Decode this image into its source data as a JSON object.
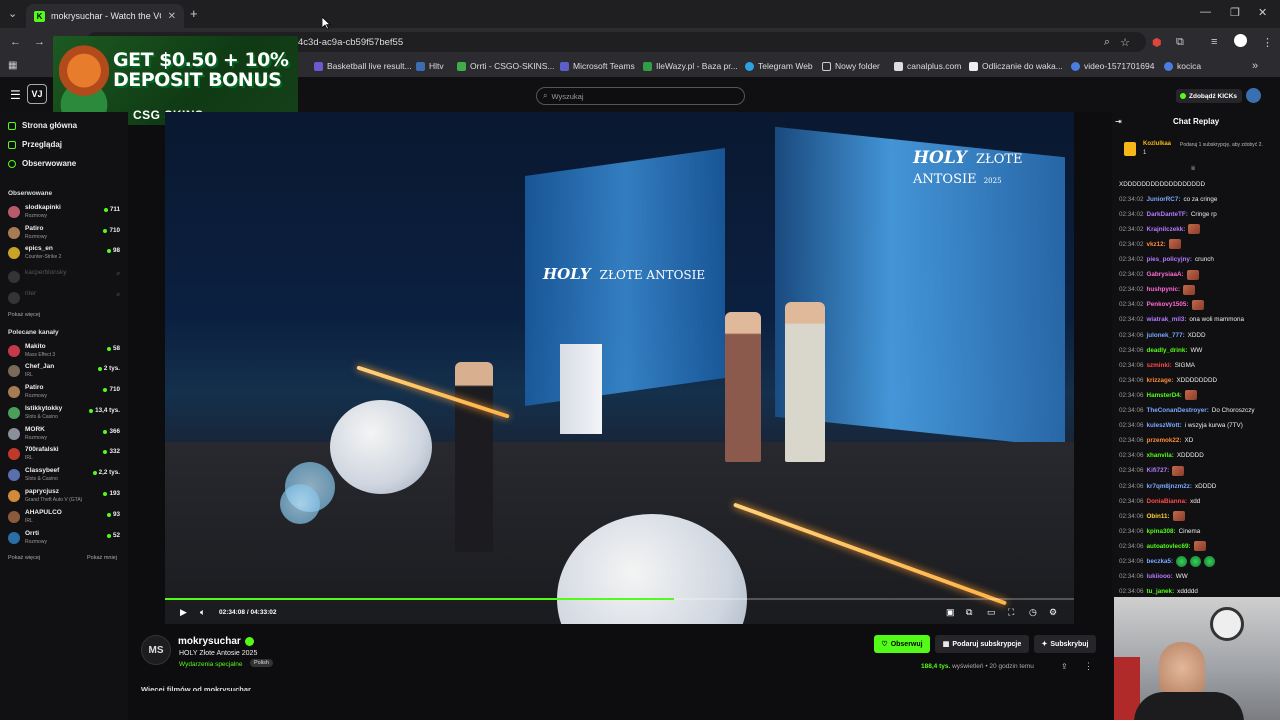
{
  "browser": {
    "tab_title": "mokrysuchar - Watch the VOD",
    "tab_favicon": "K",
    "url_fragment": "4c3d-ac9a-cb59f57bef55",
    "bookmarks": [
      "Basketball live result...",
      "Hltv",
      "Orrti - CSGO-SKINS...",
      "Microsoft Teams",
      "IleWazy.pl - Baza pr...",
      "Telegram Web",
      "Nowy folder",
      "canalplus.com",
      "Odliczanie do waka...",
      "video-1571701694",
      "kocica"
    ]
  },
  "ad": {
    "headline": "GET $0.50 + 10% DEPOSIT BONUS",
    "brand": "CSG SKINS"
  },
  "header": {
    "logo": "VJ",
    "search_placeholder": "Wyszukaj",
    "kicks_button": "Zdobądź KICKs"
  },
  "sidebar": {
    "nav": [
      {
        "label": "Strona główna"
      },
      {
        "label": "Przeglądaj"
      },
      {
        "label": "Obserwowane"
      }
    ],
    "followed_title": "Obserwowane",
    "followed": [
      {
        "name": "slodkapinki",
        "category": "Rozmowy",
        "viewers": "711"
      },
      {
        "name": "Patiro",
        "category": "Rozmowy",
        "viewers": "710"
      },
      {
        "name": "epics_en",
        "category": "Counter-Strike 2",
        "viewers": "98"
      },
      {
        "name": "kacperblonsky",
        "category": "",
        "viewers": ""
      },
      {
        "name": "riter",
        "category": "",
        "viewers": ""
      }
    ],
    "show_more_followed": "Pokaż więcej",
    "recommended_title": "Polecane kanały",
    "recommended": [
      {
        "name": "Makito",
        "category": "Mass Effect 3",
        "viewers": "58"
      },
      {
        "name": "Chef_Jan",
        "category": "IRL",
        "viewers": "2 tys."
      },
      {
        "name": "Patiro",
        "category": "Rozmowy",
        "viewers": "710"
      },
      {
        "name": "Istikkytokky",
        "category": "Slots & Casino",
        "viewers": "13,4 tys."
      },
      {
        "name": "MORK",
        "category": "Rozmowy",
        "viewers": "366"
      },
      {
        "name": "700rafalski",
        "category": "IRL",
        "viewers": "332"
      },
      {
        "name": "Classybeef",
        "category": "Slots & Casino",
        "viewers": "2,2 tys."
      },
      {
        "name": "paprycjusz",
        "category": "Grand Theft Auto V (GTA)",
        "viewers": "193"
      },
      {
        "name": "AHAPULCO",
        "category": "IRL",
        "viewers": "93"
      },
      {
        "name": "Orrti",
        "category": "Rozmowy",
        "viewers": "52"
      }
    ],
    "show_more_recommended": "Pokaż więcej",
    "show_less_recommended": "Pokaż mniej"
  },
  "player": {
    "stage_logo_brand": "HOLY",
    "stage_logo_title": "ZŁOTE ANTOSIE",
    "stage_logo_year": "2025",
    "time_current": "02:34:08",
    "time_total": "04:33:02",
    "progress": 0.56
  },
  "vod": {
    "channel_avatar": "MS",
    "channel_name": "mokrysuchar",
    "title": "HOLY Złote Antosie 2025",
    "category": "Wydarzenia specjalne",
    "language": "Polish",
    "follow_label": "Obserwuj",
    "gift_label": "Podaruj subskrypcje",
    "subscribe_label": "Subskrybuj",
    "views_count": "188,4 tys.",
    "views_label": "wyświetleń",
    "age": "20 godzin temu",
    "more_vods": "Więcej filmów od mokrysuchar"
  },
  "chat": {
    "title": "Chat Replay",
    "pinned_user": "Kozlulkaa",
    "pinned_count": "1",
    "pinned_text": "Podaruj 1 subskrypcję, aby zdobyć 2.",
    "messages": [
      {
        "time": "",
        "user": "",
        "text": "XDDDDDDDDDDDDDDDDDD",
        "color": "#eeeeee"
      },
      {
        "time": "02:34:02",
        "user": "JuniorRC7:",
        "text": "co za cringe",
        "color": "#7aa8ff"
      },
      {
        "time": "02:34:02",
        "user": "DarkDanteTF:",
        "text": "Cringe rp",
        "color": "#b47aff"
      },
      {
        "time": "02:34:02",
        "user": "Krajnilczekk:",
        "text": "",
        "color": "#b47aff",
        "emote": "face"
      },
      {
        "time": "02:34:02",
        "user": "vkz12:",
        "text": "",
        "color": "#ff8a3a",
        "emote": "face"
      },
      {
        "time": "02:34:02",
        "user": "pies_policyjny:",
        "text": "crunch",
        "color": "#b47aff"
      },
      {
        "time": "02:34:02",
        "user": "GabrysiaaA:",
        "text": "",
        "color": "#ff6ad5",
        "emote": "face"
      },
      {
        "time": "02:34:02",
        "user": "hushpynic:",
        "text": "",
        "color": "#ff6ad5",
        "emote": "face"
      },
      {
        "time": "02:34:02",
        "user": "Penkovy1505:",
        "text": "",
        "color": "#ff6ad5",
        "emote": "face"
      },
      {
        "time": "02:34:02",
        "user": "wiatrak_mil3:",
        "text": "ona woli mammona",
        "color": "#b47aff"
      },
      {
        "time": "02:34:06",
        "user": "julonek_777:",
        "text": "XDDD",
        "color": "#7aa8ff"
      },
      {
        "time": "02:34:06",
        "user": "deadly_drink:",
        "text": "WW",
        "color": "#53fc18"
      },
      {
        "time": "02:34:06",
        "user": "szminki:",
        "text": "SIGMA",
        "color": "#ff4a4a"
      },
      {
        "time": "02:34:06",
        "user": "krizzage:",
        "text": "XDDDDDDDD",
        "color": "#ff8a3a"
      },
      {
        "time": "02:34:06",
        "user": "HamsterD4:",
        "text": "",
        "color": "#53fc18",
        "emote": "face"
      },
      {
        "time": "02:34:06",
        "user": "TheConanDestroyer:",
        "text": "Do Choroszczy",
        "color": "#7aa8ff"
      },
      {
        "time": "02:34:06",
        "user": "kuleszWott:",
        "text": "i wszyja kurwa (7TV)",
        "color": "#7aa8ff"
      },
      {
        "time": "02:34:06",
        "user": "przemok22:",
        "text": "XD",
        "color": "#ff8a3a"
      },
      {
        "time": "02:34:06",
        "user": "xhanvila:",
        "text": "XDDDDD",
        "color": "#53fc18"
      },
      {
        "time": "02:34:06",
        "user": "Kifi727:",
        "text": "",
        "color": "#b47aff",
        "emote": "face"
      },
      {
        "time": "02:34:06",
        "user": "kr7qm8jnzm2z:",
        "text": "xDDDD",
        "color": "#7aa8ff"
      },
      {
        "time": "02:34:06",
        "user": "DoniaBianna:",
        "text": "xdd",
        "color": "#ff4a4a"
      },
      {
        "time": "02:34:06",
        "user": "Obin11:",
        "text": "",
        "color": "#ffd23a",
        "emote": "face"
      },
      {
        "time": "02:34:06",
        "user": "kpina308:",
        "text": "Cinema",
        "color": "#53fc18"
      },
      {
        "time": "02:34:06",
        "user": "autoatovlec69:",
        "text": "",
        "color": "#53fc18",
        "emote": "face"
      },
      {
        "time": "02:34:06",
        "user": "beczka5:",
        "text": "",
        "color": "#7aa8ff",
        "emote": "green3"
      },
      {
        "time": "02:34:06",
        "user": "lukiiooo:",
        "text": "WW",
        "color": "#b47aff"
      },
      {
        "time": "02:34:06",
        "user": "tu_janek:",
        "text": "xddddd",
        "color": "#53fc18"
      }
    ]
  },
  "colors": {
    "accent": "#53fc18",
    "background": "#0d0d0f"
  }
}
